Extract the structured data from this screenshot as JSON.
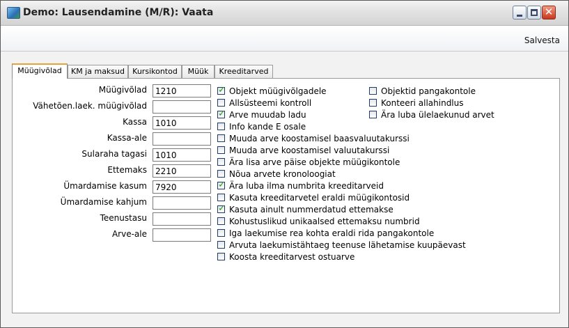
{
  "window": {
    "title": "Demo: Lausendamine (M/R): Vaata"
  },
  "toolbar": {
    "save_label": "Salvesta"
  },
  "tabs": [
    {
      "label": "Müügivõlad",
      "active": true
    },
    {
      "label": "KM ja maksud",
      "active": false
    },
    {
      "label": "Kursikontod",
      "active": false
    },
    {
      "label": "Müük",
      "active": false
    },
    {
      "label": "Kreeditarved",
      "active": false
    }
  ],
  "fields": [
    {
      "label": "Müügivõlad",
      "value": "1210"
    },
    {
      "label": "Vähetõen.laek. müügivõlad",
      "value": ""
    },
    {
      "label": "Kassa",
      "value": "1010"
    },
    {
      "label": "Kassa-ale",
      "value": ""
    },
    {
      "label": "Sularaha tagasi",
      "value": "1010"
    },
    {
      "label": "Ettemaks",
      "value": "2210"
    },
    {
      "label": "Ümardamise kasum",
      "value": "7920"
    },
    {
      "label": "Ümardamise kahjum",
      "value": ""
    },
    {
      "label": "Teenustasu",
      "value": ""
    },
    {
      "label": "Arve-ale",
      "value": ""
    }
  ],
  "checkboxes_col1": [
    {
      "label": "Objekt müügivõlgadele",
      "checked": true
    },
    {
      "label": "Allsüsteemi kontroll",
      "checked": false
    },
    {
      "label": "Arve muudab ladu",
      "checked": true
    },
    {
      "label": "Info kande E osale",
      "checked": false
    },
    {
      "label": "Muuda arve koostamisel baasvaluutakurssi",
      "checked": false
    },
    {
      "label": "Muuda arve koostamisel valuutakurssi",
      "checked": false
    },
    {
      "label": "Ära lisa arve päise objekte müügikontole",
      "checked": false
    },
    {
      "label": "Nõua arvete kronoloogiat",
      "checked": false
    },
    {
      "label": "Ära luba ilma numbrita kreeditarveid",
      "checked": true
    },
    {
      "label": "Kasuta kreeditarvetel eraldi müügikontosid",
      "checked": false
    },
    {
      "label": "Kasuta ainult nummerdatud ettemakse",
      "checked": true
    },
    {
      "label": "Kohustuslikud unikaalsed ettemaksu numbrid",
      "checked": false
    },
    {
      "label": "Iga laekumise rea kohta eraldi rida pangakontole",
      "checked": false
    },
    {
      "label": "Arvuta laekumistähtaeg teenuse lähetamise kuupäevast",
      "checked": false
    },
    {
      "label": "Koosta kreeditarvest ostuarve",
      "checked": false
    }
  ],
  "checkboxes_col2": [
    {
      "label": "Objektid pangakontole",
      "checked": false
    },
    {
      "label": "Konteeri allahindlus",
      "checked": false
    },
    {
      "label": "Ära luba ülelaekunud arvet",
      "checked": false
    }
  ]
}
